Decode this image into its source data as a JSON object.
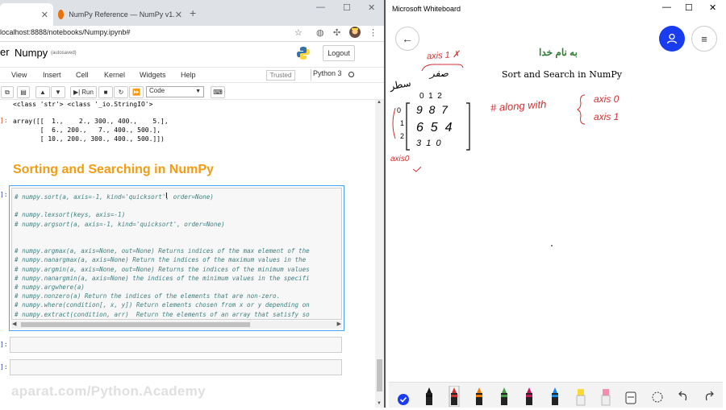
{
  "browser": {
    "tabs": [
      {
        "label": ""
      },
      {
        "label": "NumPy Reference — NumPy v1."
      }
    ],
    "new_tab_icon": "plus-icon",
    "window_controls": [
      "—",
      "☐",
      "✕"
    ],
    "url": "localhost:8888/notebooks/Numpy.ipynb#"
  },
  "jupyter": {
    "logo_fragment": "er",
    "notebook_title": "Numpy",
    "autosave": "(autosaved)",
    "logout_label": "Logout",
    "menu": [
      "View",
      "Insert",
      "Cell",
      "Kernel",
      "Widgets",
      "Help"
    ],
    "trusted": "Trusted",
    "kernel": "Python 3",
    "run_label": "Run",
    "cell_type": "Code"
  },
  "notebook": {
    "output_line1": "<class 'str'> <class '_io.StringIO'>",
    "out_prompt": "]:",
    "array_output": "array([[  1.,    2., 300., 400.,    5.],\n       [  6., 200.,   7., 400., 500.],\n       [ 10., 200., 300., 400., 500.]])",
    "heading": "Sorting and Searching in NumPy",
    "in_prompt": "]:",
    "code_lines": [
      "# numpy.sort(a, axis=-1, kind='quicksort', order=None)",
      "",
      "# numpy.lexsort(keys, axis=-1)",
      "# numpy.argsort(a, axis=-1, kind='quicksort', order=None)",
      "",
      "",
      "# numpy.argmax(a, axis=None, out=None) Returns indices of the max element of the",
      "# numpy.nanargmax(a, axis=None) Return the indices of the maximum values in the",
      "# numpy.argmin(a, axis=None, out=None) Returns the indices of the minimum values",
      "# numpy.nanargmin(a, axis=None) the indices of the minimum values in the specifi",
      "# numpy.argwhere(a)",
      "# numpy.nonzero(a) Return the indices of the elements that are non-zero.",
      "# numpy.where(condition[, x, y]) Return elements chosen from x or y depending on",
      "# numpy.extract(condition, arr)  Return the elements of an array that satisfy so"
    ],
    "empty_prompt_1": "]:",
    "empty_prompt_2": "]:",
    "watermark": "aparat.com/Python.Academy"
  },
  "whiteboard": {
    "title": "Microsoft Whiteboard",
    "window_controls": [
      "—",
      "☐",
      "✕"
    ],
    "persian_heading": "به نام خدا",
    "subtitle": "Sort and Search in NumPy",
    "hand_axis1_top": "axis 1 ✗",
    "hand_safar": "صفر",
    "hand_row_indices": "0  1  2",
    "hand_satr": "سطر",
    "hand_matrix_rows": [
      "9  8  7",
      "6  5  4",
      "3  1  0"
    ],
    "hand_left_indices": [
      "0",
      "1",
      "2"
    ],
    "hand_axis0_bottom": "axis0",
    "hand_along_with": "# along with",
    "hand_axis_options": [
      "axis 0",
      "axis 1"
    ],
    "toolbar_icons": [
      "touch-icon",
      "black-pen-icon",
      "red-pen-icon",
      "orange-pen-icon",
      "green-pen-icon",
      "magenta-pen-icon",
      "blue-pen-icon",
      "yellow-highlighter-icon",
      "pink-highlighter-icon",
      "eraser-icon",
      "lasso-icon",
      "undo-icon",
      "redo-icon"
    ],
    "colors": {
      "user_button": "#1a3cf0",
      "pen_red": "#d32f2f",
      "heading_green": "#2e7d32"
    }
  }
}
